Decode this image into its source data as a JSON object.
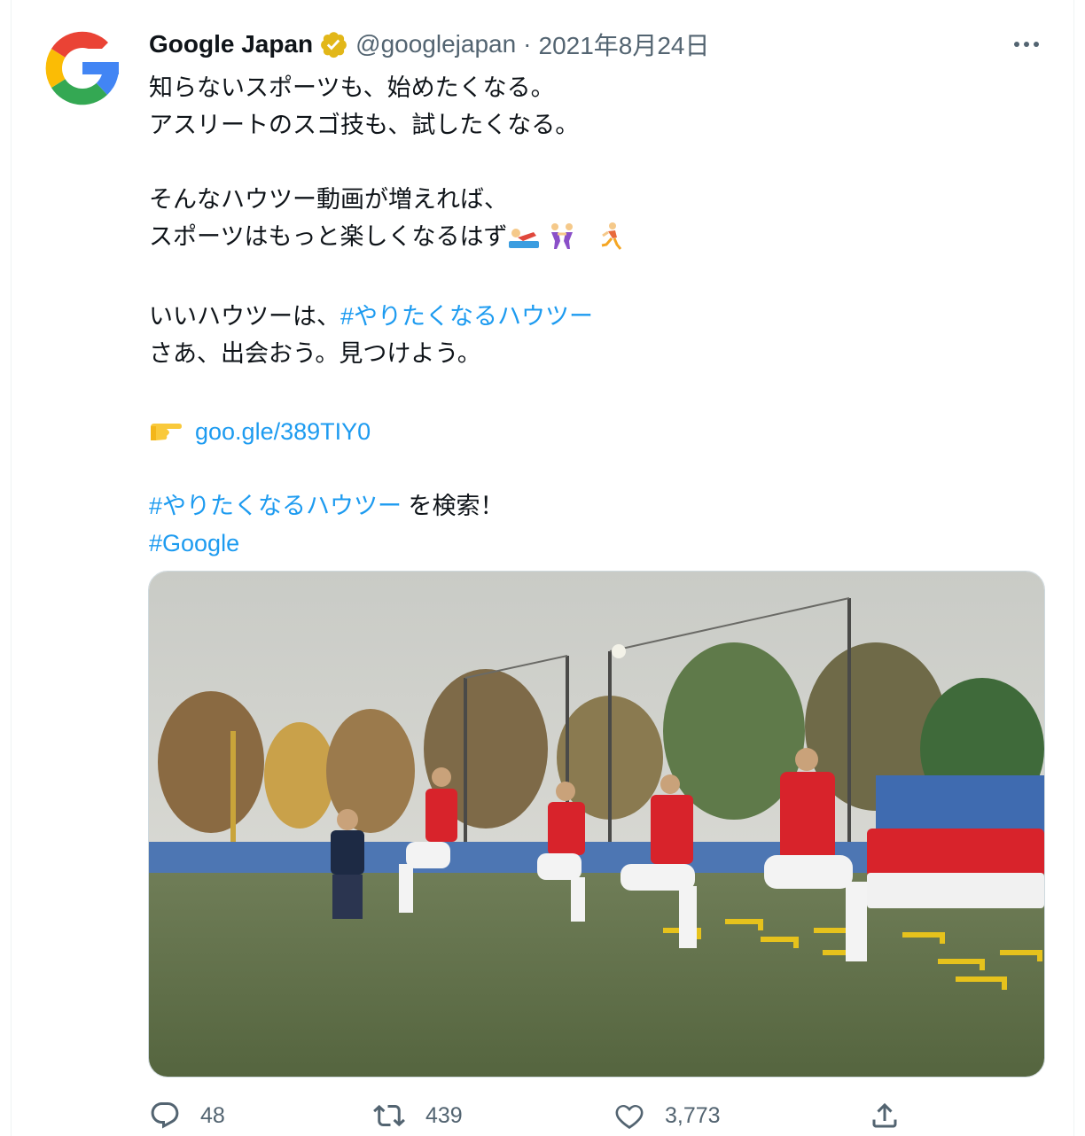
{
  "tweet": {
    "author_name": "Google Japan",
    "handle": "@googlejapan",
    "separator": "·",
    "date": "2021年8月24日",
    "lines": {
      "l1": "知らないスポーツも、始めたくなる。",
      "l2": "アスリートのスゴ技も、試したくなる。",
      "l3": "そんなハウツー動画が増えれば、",
      "l4": "スポーツはもっと楽しくなるはず",
      "l5_text": "いいハウツーは、",
      "l5_hashtag": "#やりたくなるハウツー",
      "l6": "さあ、出会おう。見つけよう。",
      "l7_link": "goo.gle/389TIY0",
      "l8_hashtag": "#やりたくなるハウツー",
      "l8_text": " を検索！",
      "l9_hashtag": "#Google"
    },
    "emoji_icons": [
      "swimmer-icon",
      "wrestlers-icon",
      "runner-icon",
      "pointing-hand-icon"
    ]
  },
  "actions": {
    "reply_count": "48",
    "retweet_count": "439",
    "like_count": "3,773"
  },
  "colors": {
    "link": "#1d9bf0",
    "secondary_text": "#536471",
    "verified_badge": "#e2b719"
  }
}
